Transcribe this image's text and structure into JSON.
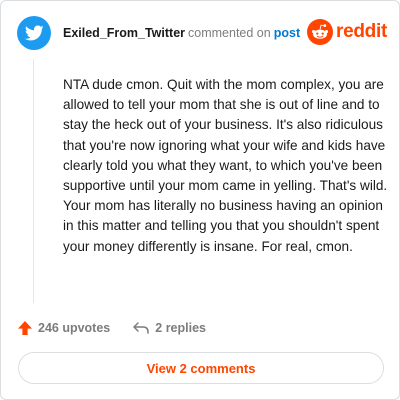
{
  "header": {
    "username": "Exiled_From_Twitter",
    "connector": "commented on",
    "post_link": "post",
    "brand_name": "reddit"
  },
  "comment": {
    "body": "NTA dude cmon. Quit with the mom complex, you are allowed to tell your mom that she is out of line and to stay the heck out of your business. It's also ridiculous that you're now ignoring what your wife and kids have clearly told you what they want, to which you've been supportive until your mom came in yelling. That's wild. Your mom has literally no business having an opinion in this matter and telling you that you shouldn't spent your money differently is insane. For real, cmon."
  },
  "actions": {
    "upvotes": "246 upvotes",
    "replies": "2 replies"
  },
  "footer": {
    "view_comments": "View 2 comments"
  },
  "icons": {
    "avatar": "twitter-bird-icon",
    "brand": "reddit-snoo-icon",
    "upvote": "upvote-arrow-icon",
    "reply": "reply-arrow-icon"
  },
  "colors": {
    "accent": "#ff4500",
    "link": "#0079d3",
    "avatar_bg": "#1d9bf0",
    "muted": "#7c7c7c",
    "text": "#1a1a1b"
  }
}
